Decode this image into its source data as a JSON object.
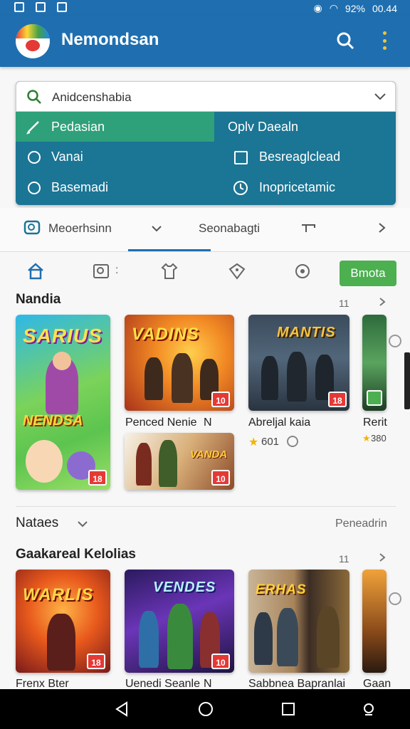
{
  "status": {
    "battery": "92%",
    "time": "00.44"
  },
  "app": {
    "title": "Nemondsan"
  },
  "search": {
    "value": "Anidcenshabia"
  },
  "options": {
    "row1_left": "Pedasian",
    "row1_right": "Oplv Daealn",
    "row2_left": "Vanai",
    "row2_right": "Besreaglclead",
    "row3_left": "Basemadi",
    "row3_right": "Inopricetamic"
  },
  "filters": {
    "left": "Meoerhsinn",
    "center": "Seonabagti"
  },
  "toolbar": {
    "more_button": "Bmota"
  },
  "section1": {
    "title": "Nandia",
    "count": "11",
    "cards": [
      {
        "art_title": "SARIUS",
        "art_subtitle": "NENDSA",
        "badge": "18"
      },
      {
        "art_title": "VADINS",
        "badge": "10",
        "caption": "Penced Nenie",
        "caption_suffix": "N"
      },
      {
        "art_title": "MANTIS",
        "badge": "18",
        "caption": "Abreljal kaia",
        "rating": "601"
      },
      {
        "caption": "Rerit",
        "rating": "380"
      }
    ],
    "lower_card": {
      "art_title": "VANDA",
      "badge": "10"
    }
  },
  "section2": {
    "header": "Nataes",
    "link": "Peneadrin"
  },
  "section3": {
    "title": "Gaakareal Kelolias",
    "count": "11",
    "cards": [
      {
        "art_title": "WARLIS",
        "badge": "18",
        "caption": "Frenx Bter"
      },
      {
        "art_title": "VENDES",
        "badge": "10",
        "caption": "Uenedi Seanle",
        "caption_suffix": "N"
      },
      {
        "art_title": "ERHAS",
        "caption": "Sabbnea Bapranlai"
      },
      {
        "caption": "Gaan"
      }
    ]
  },
  "colors": {
    "primary": "#1f6fb0",
    "panel": "#1b7594",
    "selected": "#2ea07a",
    "accent_button": "#4caf50"
  }
}
